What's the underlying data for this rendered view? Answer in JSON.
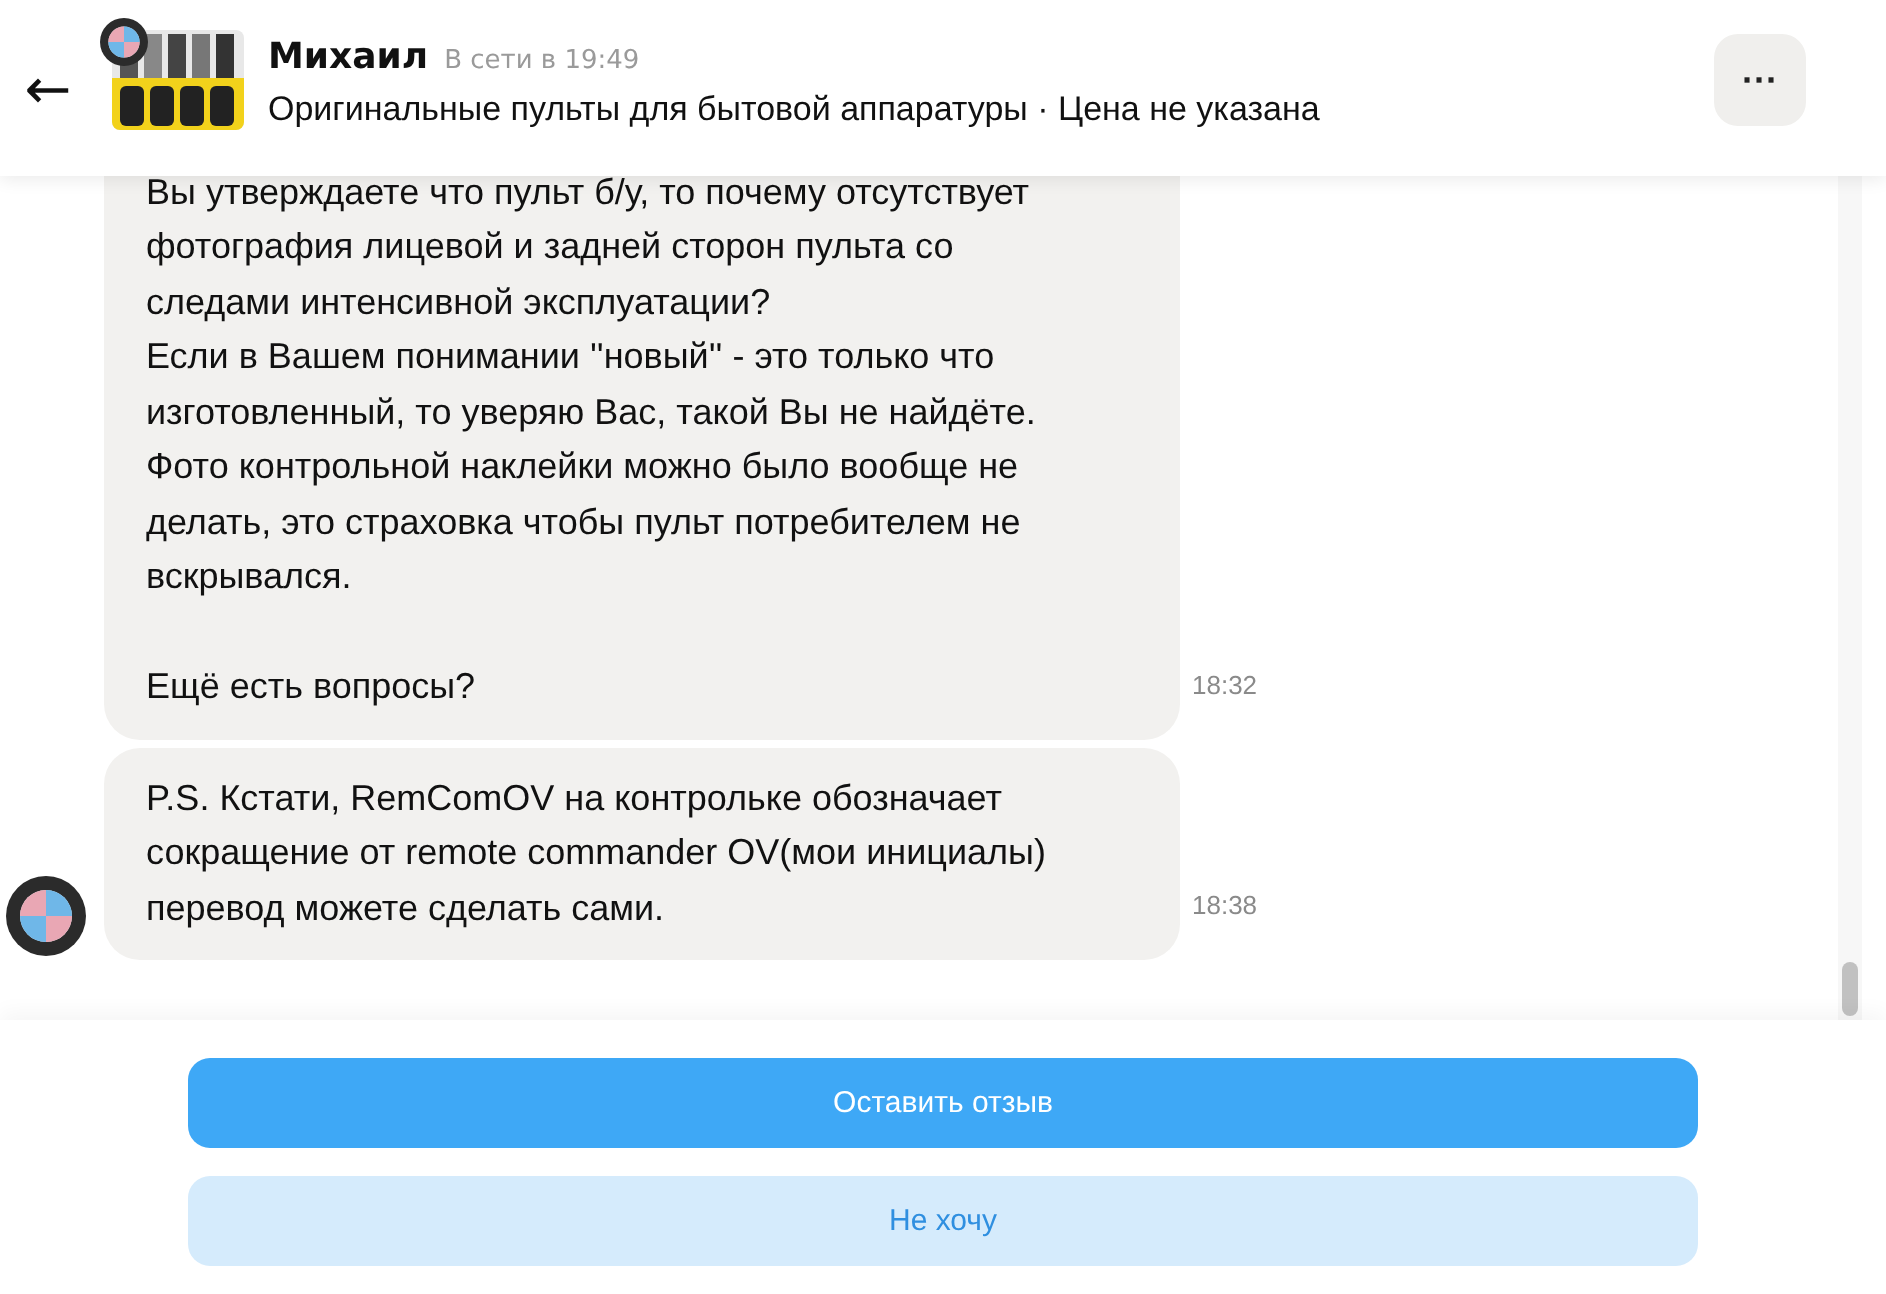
{
  "header": {
    "back_label": "←",
    "name": "Михаил",
    "presence": "В сети в 19:49",
    "listing": "Оригинальные пульты для бытовой аппаратуры · Цена не указана",
    "menu_label": "···"
  },
  "messages": [
    {
      "text": "Вы утверждаете что пульт б/у, то почему отсутствует\nфотография лицевой и задней сторон пульта со\nследами интенсивной эксплуатации?\nЕсли в Вашем понимании ''новый'' - это только что\nизготовленный, то уверяю Вас, такой Вы не найдёте.\nФото контрольной наклейки можно было вообще не\nделать, это страховка чтобы пульт потребителем не\nвскрывался.\n\nЕщё есть вопросы?",
      "time": "18:32",
      "show_avatar": false
    },
    {
      "text": "P.S. Кстати, RemComOV на контрольке обозначает\nсокращение от remote commander OV(мои инициалы)\nперевод можете сделать сами.",
      "time": "18:38",
      "show_avatar": true
    }
  ],
  "actions": [
    {
      "label": "Оставить отзыв",
      "kind": "primary"
    },
    {
      "label": "Не хочу",
      "kind": "secondary"
    }
  ]
}
